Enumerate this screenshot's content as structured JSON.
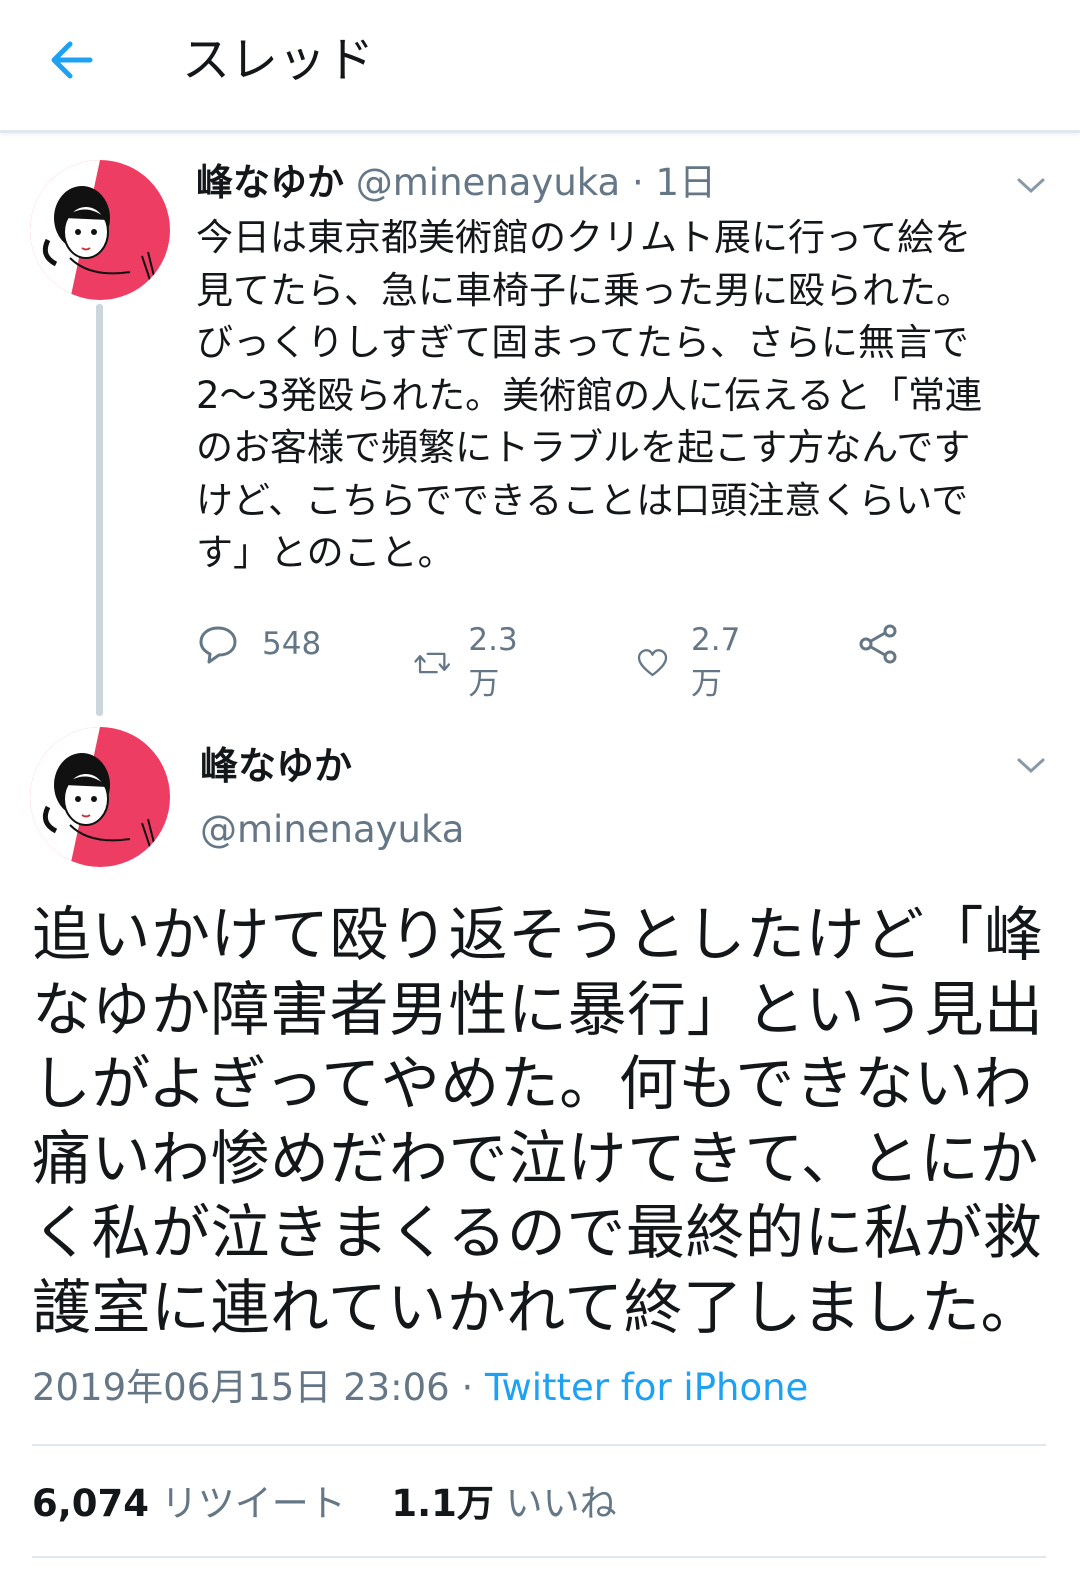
{
  "header": {
    "title": "スレッド"
  },
  "tweet1": {
    "name": "峰なゆか",
    "handle": "@minenayuka",
    "time": "1日",
    "text": "今日は東京都美術館のクリムト展に行って絵を\n見てたら、急に車椅子に乗った男に殴られた。\nびっくりしすぎて固まってたら、さらに無言で\n2〜3発殴られた。美術館の人に伝えると「常連\nのお客様で頻繁にトラブルを起こす方なんです\nけど、こちらでできることは口頭注意くらいで\nす」とのこと。",
    "replies": "548",
    "retweets": "2.3万",
    "likes": "2.7万"
  },
  "tweet2": {
    "name": "峰なゆか",
    "handle": "@minenayuka",
    "text": "追いかけて殴り返そうとしたけど「峰\nなゆか障害者男性に暴行」という見出\nしがよぎってやめた。何もできないわ\n痛いわ惨めだわで泣けてきて、とにか\nく私が泣きまくるので最終的に私が救\n護室に連れていかれて終了しました。",
    "timestamp": "2019年06月15日 23:06",
    "source": "Twitter for iPhone",
    "retweet_count": "6,074",
    "retweet_label": "リツイート",
    "like_count": "1.1万",
    "like_label": "いいね"
  },
  "colors": {
    "accent": "#1da1f2",
    "muted": "#657786",
    "avatar_bg": "#ee3d63"
  }
}
